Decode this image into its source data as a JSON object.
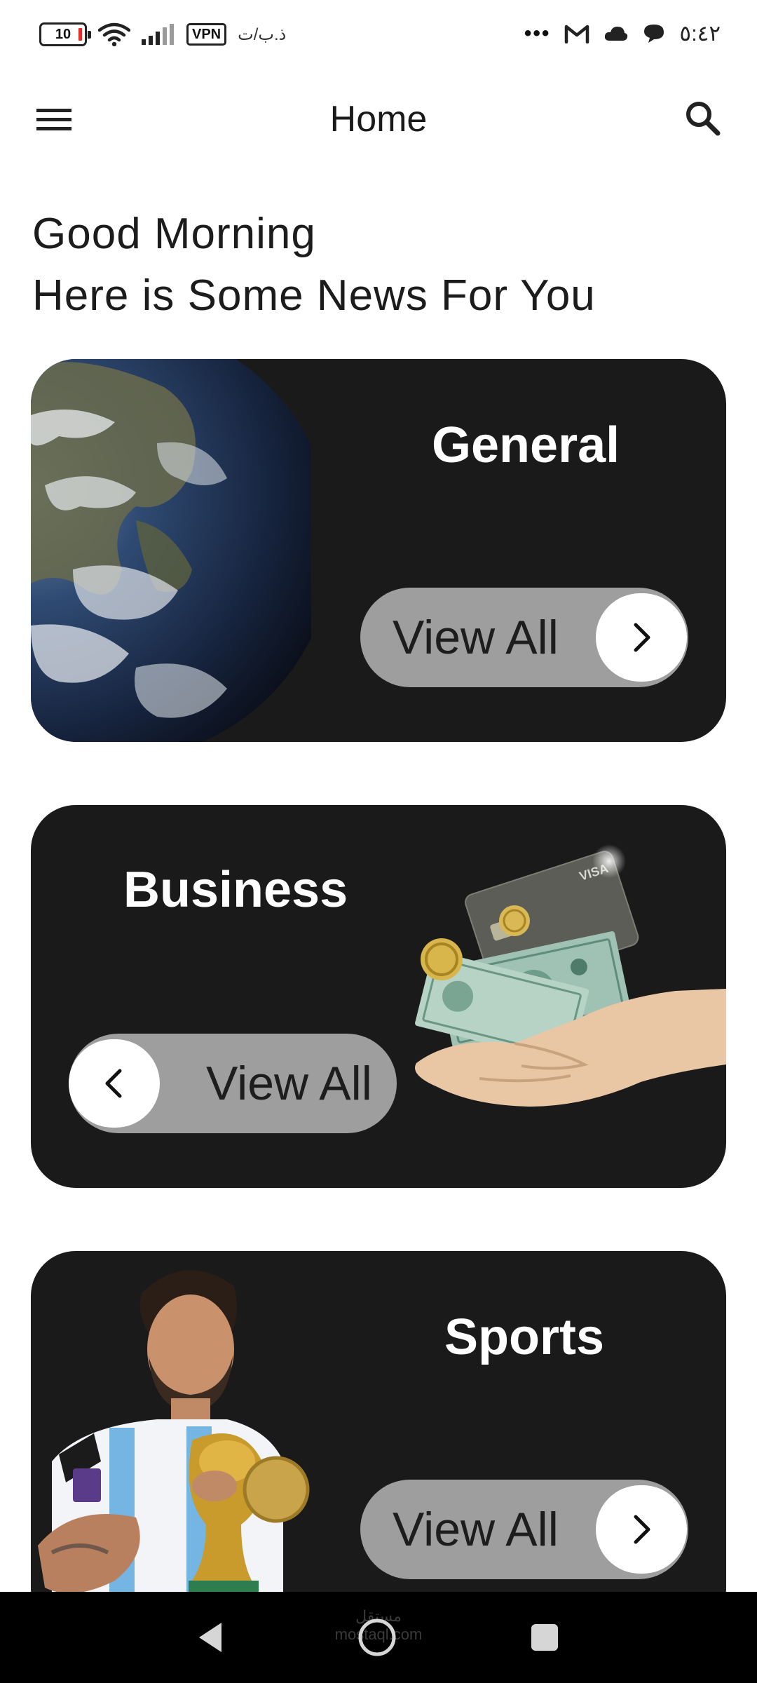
{
  "status_bar": {
    "battery_level": "10",
    "vpn_label": "VPN",
    "carrier": "ذ.ب/ت",
    "overflow": "•••",
    "time": "٥:٤٢",
    "icons": [
      "wifi-icon",
      "signal-icon",
      "gmail-icon",
      "cloud-icon",
      "chat-bubble-icon"
    ]
  },
  "app_bar": {
    "title": "Home",
    "menu_icon": "hamburger-menu-icon",
    "search_icon": "search-icon"
  },
  "greeting": {
    "line1": "Good Morning",
    "line2": "Here is Some News For You"
  },
  "categories": [
    {
      "title": "General",
      "button_label": "View All",
      "arrow": "chevron-right-icon",
      "image": "earth-globe-image"
    },
    {
      "title": "Business",
      "button_label": "View All",
      "arrow": "chevron-left-icon",
      "image": "hand-with-money-and-card-image"
    },
    {
      "title": "Sports",
      "button_label": "View All",
      "arrow": "chevron-right-icon",
      "image": "footballer-with-trophy-image"
    }
  ],
  "nav_bar": {
    "watermark": "مستقل mostaql.com",
    "buttons": [
      "back-icon",
      "home-icon",
      "recents-icon"
    ]
  },
  "colors": {
    "card_background": "#1b1a1b",
    "button_background": "#9e9e9e",
    "page_background": "#ffffff",
    "nav_background": "#000000"
  }
}
